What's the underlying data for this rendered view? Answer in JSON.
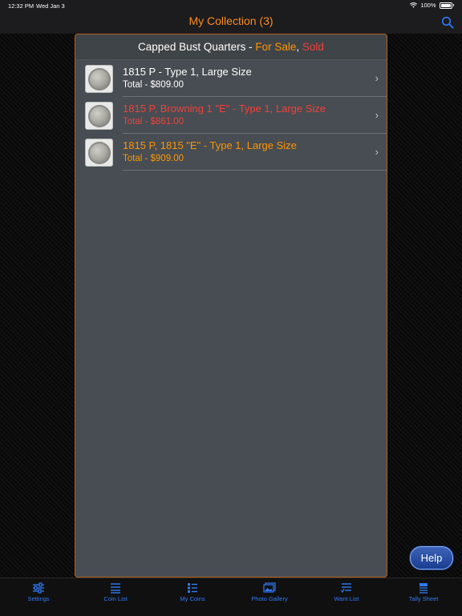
{
  "status": {
    "time": "12:32 PM",
    "date": "Wed Jan 3",
    "battery": "100%"
  },
  "nav": {
    "title": "My Collection (3)"
  },
  "panel": {
    "header_prefix": "Capped Bust Quarters - ",
    "header_for_sale": "For Sale",
    "header_sep": ", ",
    "header_sold": "Sold"
  },
  "rows": [
    {
      "title": "1815 P - Type 1, Large Size",
      "total": "Total - $809.00",
      "color": "#ffffff"
    },
    {
      "title": "1815 P, Browning 1 \"E\" - Type 1, Large Size",
      "total": "Total - $861.00",
      "color": "#f0403a"
    },
    {
      "title": "1815 P, 1815 \"E\" - Type 1, Large Size",
      "total": "Total - $909.00",
      "color": "#ff9500"
    }
  ],
  "help_label": "Help",
  "tabs": [
    {
      "label": "Settings",
      "icon": "settings-sliders-icon"
    },
    {
      "label": "Coin List",
      "icon": "list-icon"
    },
    {
      "label": "My Coins",
      "icon": "my-coins-icon"
    },
    {
      "label": "Photo Gallery",
      "icon": "photo-gallery-icon"
    },
    {
      "label": "Want List",
      "icon": "want-list-icon"
    },
    {
      "label": "Tally Sheet",
      "icon": "tally-sheet-icon"
    }
  ],
  "colors": {
    "accent": "#ff8c1a",
    "tab_blue": "#2f7bf5",
    "sold_red": "#f0403a",
    "for_sale_orange": "#ff9500"
  }
}
